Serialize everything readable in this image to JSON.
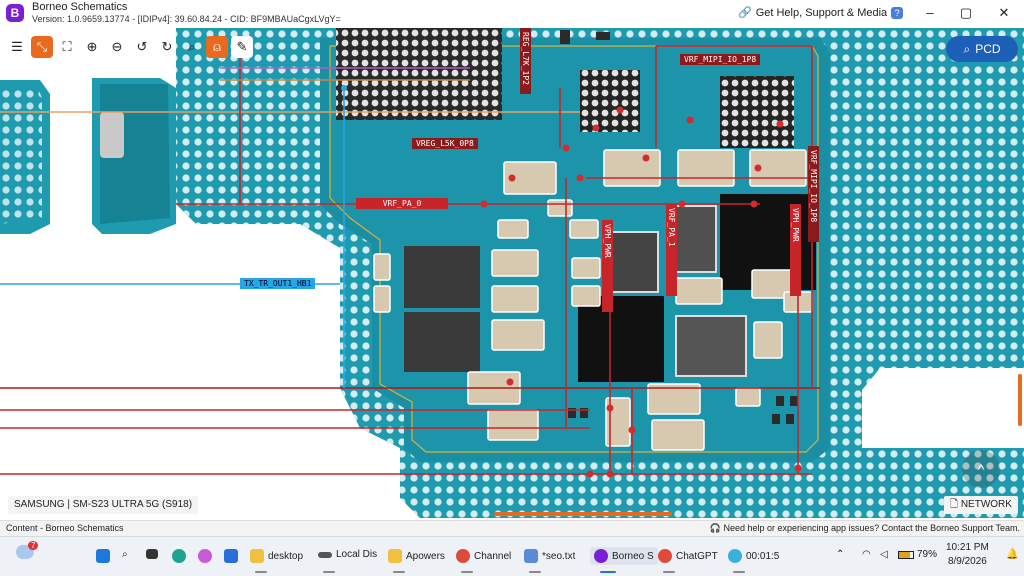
{
  "window": {
    "title": "Borneo Schematics",
    "version": "Version: 1.0.9659.13774 - [IDIPv4]: 39.60.84.24 - CID: BF9MBAUaCgxLVgY=",
    "help_label": "Get Help, Support & Media",
    "help_badge": "?",
    "minimize": "–",
    "maximize": "▢",
    "close": "✕"
  },
  "toolbar": {
    "items": [
      {
        "icon": "list-icon",
        "glyph": "☰"
      },
      {
        "icon": "compress-icon",
        "glyph": "⤡"
      },
      {
        "icon": "expand-icon",
        "glyph": "⛶"
      },
      {
        "icon": "zoom-in-icon",
        "glyph": "⊕"
      },
      {
        "icon": "zoom-out-icon",
        "glyph": "⊖"
      },
      {
        "icon": "rotate-left-icon",
        "glyph": "↺"
      },
      {
        "icon": "rotate-right-icon",
        "glyph": "↻"
      },
      {
        "icon": "search-icon",
        "glyph": "⌕"
      },
      {
        "icon": "mouse-icon",
        "glyph": "⍝"
      },
      {
        "icon": "pen-icon",
        "glyph": "✎"
      }
    ],
    "pcd_label": "PCD"
  },
  "nets": {
    "vreg_l5k": "VREG_L5K_0P8",
    "vreg_l7k": "REG_L7K_1P2",
    "vrf_mipi_io": "VRF_MIPI_IO_1P8",
    "vrf_mipi_io_vert": "VRF_MIPI_IO_1P8",
    "vrf_pa_0": "VRF_PA_0",
    "vrf_pa_1": "VRF_PA_1",
    "vph_pwr_a": "VPH_PWR",
    "vph_pwr_b": "VPH_PWR",
    "tx_tr": "TX_TR_OUT1_HB1"
  },
  "board": {
    "device": "SAMSUNG | SM-S23 ULTRA 5G (S918)",
    "network_button": "NETWORK",
    "scroll_up": "^"
  },
  "status": {
    "left": "Content - Borneo Schematics",
    "right": "Need help or experiencing app issues? Contact the Borneo Support Team."
  },
  "taskbar": {
    "weather_badge": "7",
    "apps": [
      {
        "label": "desktop"
      },
      {
        "label": "Local Dis"
      },
      {
        "label": "Apowers"
      },
      {
        "label": "Channel"
      },
      {
        "label": "*seo.txt"
      },
      {
        "label": "Borneo S"
      },
      {
        "label": "ChatGPT"
      },
      {
        "label": "00:01:5"
      }
    ],
    "battery": "79%",
    "time": "10:21 PM",
    "date": "8/9/2026"
  },
  "colors": {
    "board": "#1f9bb0",
    "board_dark": "#167a8c",
    "net_red": "#c8252b",
    "accent": "#e86a1e",
    "pcd": "#1e5fb8"
  }
}
